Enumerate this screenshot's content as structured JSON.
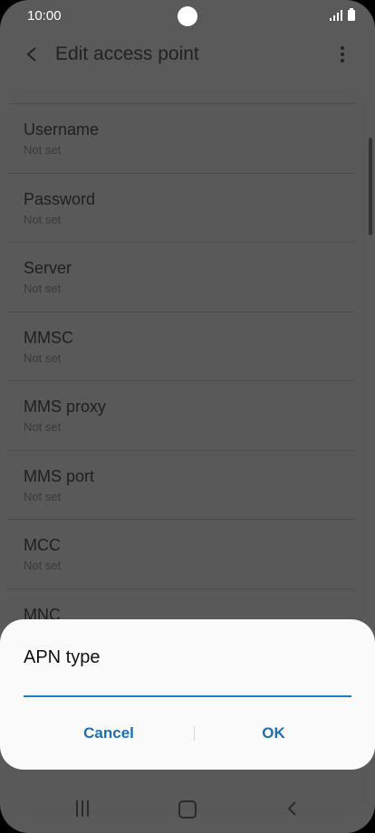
{
  "status_bar": {
    "time": "10:00"
  },
  "app_bar": {
    "title": "Edit access point"
  },
  "settings": [
    {
      "label": "Username",
      "value": "Not set"
    },
    {
      "label": "Password",
      "value": "Not set"
    },
    {
      "label": "Server",
      "value": "Not set"
    },
    {
      "label": "MMSC",
      "value": "Not set"
    },
    {
      "label": "MMS proxy",
      "value": "Not set"
    },
    {
      "label": "MMS port",
      "value": "Not set"
    },
    {
      "label": "MCC",
      "value": "Not set"
    },
    {
      "label": "MNC",
      "value": ""
    }
  ],
  "dialog": {
    "title": "APN type",
    "input_value": "",
    "cancel_label": "Cancel",
    "ok_label": "OK"
  },
  "colors": {
    "accent": "#1b7fc4",
    "button_text": "#1f6fb0",
    "scrim_bg": "#5a5a5a"
  },
  "icons": {
    "back": "chevron-left-icon",
    "more": "more-vertical-icon",
    "signal": "signal-icon",
    "battery": "battery-icon",
    "nav_recent": "recent-apps-icon",
    "nav_home": "home-icon",
    "nav_back": "back-icon"
  }
}
